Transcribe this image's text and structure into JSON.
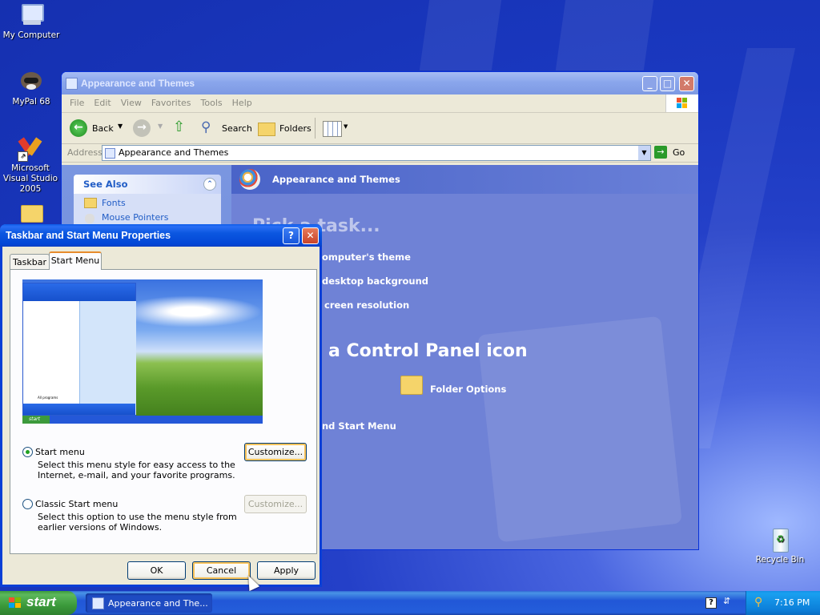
{
  "desktop": {
    "icons": [
      {
        "label": "My Computer"
      },
      {
        "label": "MyPal 68"
      },
      {
        "label": "Microsoft Visual Studio 2005"
      },
      {
        "label": "Recycle Bin"
      }
    ]
  },
  "explorer": {
    "title": "Appearance and Themes",
    "menu": [
      "File",
      "Edit",
      "View",
      "Favorites",
      "Tools",
      "Help"
    ],
    "toolbar": {
      "back": "Back",
      "search": "Search",
      "folders": "Folders"
    },
    "address_label": "Address",
    "address_value": "Appearance and Themes",
    "go": "Go",
    "see_also": {
      "title": "See Also",
      "items": [
        "Fonts",
        "Mouse Pointers"
      ]
    },
    "heading": "Appearance and Themes",
    "pick_task": "Pick a task...",
    "tasks": [
      "omputer's theme",
      "desktop background",
      "creen resolution"
    ],
    "pick_icon": "a Control Panel icon",
    "icons": [
      "Folder Options",
      "nd Start Menu"
    ]
  },
  "dialog": {
    "title": "Taskbar and Start Menu Properties",
    "tabs": [
      "Taskbar",
      "Start Menu"
    ],
    "preview": {
      "all_programs": "All programs",
      "start": "start"
    },
    "option_start": {
      "label": "Start menu",
      "desc_1": "Select this menu style for easy access to the",
      "desc_2": "Internet, e-mail, and your favorite programs.",
      "customize": "Customize..."
    },
    "option_classic": {
      "label": "Classic Start menu",
      "desc_1": "Select this option to use the menu style from",
      "desc_2": "earlier versions of Windows.",
      "customize": "Customize..."
    },
    "ok": "OK",
    "cancel": "Cancel",
    "apply": "Apply"
  },
  "taskbar": {
    "start": "start",
    "task": "Appearance and The...",
    "clock": "7:16 PM"
  }
}
